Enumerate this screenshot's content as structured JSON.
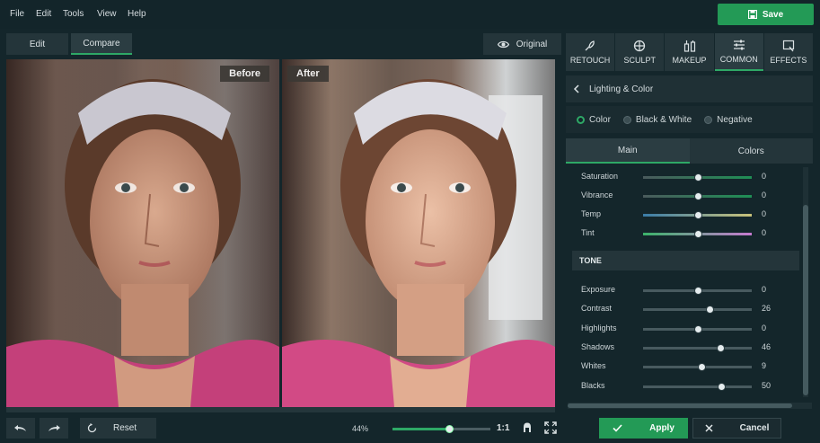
{
  "menu": {
    "file": "File",
    "edit": "Edit",
    "tools": "Tools",
    "view": "View",
    "help": "Help",
    "save": "Save"
  },
  "toolbar": {
    "edit_tab": "Edit",
    "compare_tab": "Compare",
    "original": "Original"
  },
  "compare": {
    "before_label": "Before",
    "after_label": "After"
  },
  "bottom": {
    "reset": "Reset",
    "zoom": "44%",
    "zoom_level": 0.58,
    "ratio": "1:1",
    "apply": "Apply",
    "cancel": "Cancel"
  },
  "tools": [
    {
      "label": "RETOUCH",
      "icon": "retouch-brush-icon"
    },
    {
      "label": "SCULPT",
      "icon": "sculpt-crosshair-icon"
    },
    {
      "label": "MAKEUP",
      "icon": "makeup-bottles-icon"
    },
    {
      "label": "COMMON",
      "icon": "sliders-icon",
      "active": true
    },
    {
      "label": "EFFECTS",
      "icon": "effects-frame-icon"
    }
  ],
  "panel": {
    "title": "Lighting & Color",
    "modes": [
      "Color",
      "Black & White",
      "Negative"
    ],
    "subtabs": [
      "Main",
      "Colors"
    ],
    "tone_header": "TONE"
  },
  "color_sliders": [
    {
      "label": "Saturation",
      "value": "0",
      "position": 0.5
    },
    {
      "label": "Vibrance",
      "value": "0",
      "position": 0.5
    },
    {
      "label": "Temp",
      "value": "0",
      "position": 0.5
    },
    {
      "label": "Tint",
      "value": "0",
      "position": 0.5
    }
  ],
  "tone_sliders": [
    {
      "label": "Exposure",
      "value": "0",
      "position": 0.5
    },
    {
      "label": "Contrast",
      "value": "26",
      "position": 0.61
    },
    {
      "label": "Highlights",
      "value": "0",
      "position": 0.5
    },
    {
      "label": "Shadows",
      "value": "46",
      "position": 0.71
    },
    {
      "label": "Whites",
      "value": "9",
      "position": 0.54
    },
    {
      "label": "Blacks",
      "value": "50",
      "position": 0.72
    }
  ],
  "colors": {
    "accent": "#2ea866",
    "button_green": "#239a56",
    "background": "#14262b"
  }
}
